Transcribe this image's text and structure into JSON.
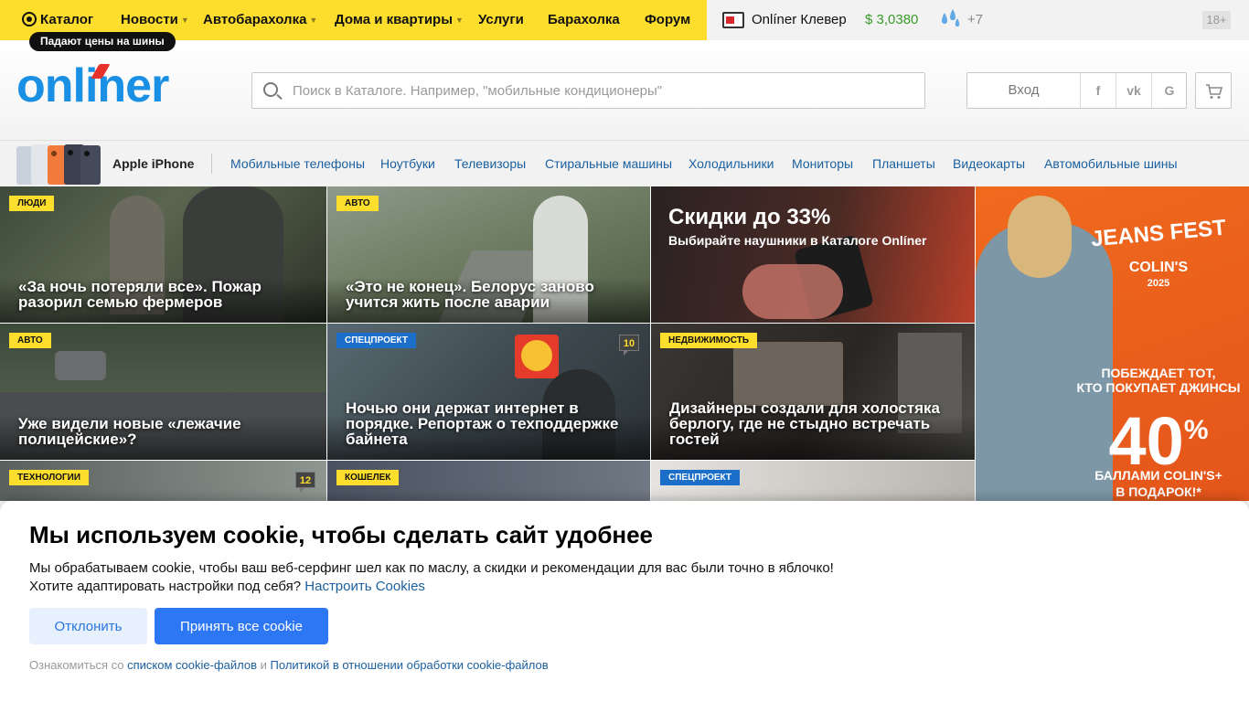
{
  "topnav": {
    "catalog": "Каталог",
    "items": [
      "Новости",
      "Автобарахолка",
      "Дома и квартиры",
      "Услуги",
      "Барахолка",
      "Форум"
    ],
    "promo": "Падают цены на шины",
    "clever": "Onlíner Клевер",
    "rate": "$ 3,0380",
    "temperature": "+7",
    "age": "18+"
  },
  "header": {
    "logo": "onliner",
    "search_placeholder": "Поиск в Каталоге. Например, \"мобильные кондиционеры\"",
    "login": "Вход",
    "social": [
      "f",
      "vk",
      "G"
    ]
  },
  "strip": {
    "featured": "Apple iPhone",
    "links": [
      "Мобильные телефоны",
      "Ноутбуки",
      "Телевизоры",
      "Стиральные машины",
      "Холодильники",
      "Мониторы",
      "Планшеты",
      "Видеокарты",
      "Автомобильные шины"
    ]
  },
  "tiles": [
    {
      "tag": "люди",
      "title": "«За ночь потеряли все». Пожар разорил семью фермеров",
      "count": ""
    },
    {
      "tag": "авто",
      "title": "«Это не конец». Белорус заново учится жить после аварии",
      "count": ""
    },
    {
      "tag": "",
      "title": "",
      "count": "",
      "promo_head": "Скидки до 33%",
      "promo_sub": "Выбирайте наушники в Каталоге Onlíner"
    },
    {
      "tag": "авто",
      "title": "Уже видели новые «лежачие полицейские»?",
      "count": ""
    },
    {
      "tag": "спецпроект",
      "title": "Ночью они держат интернет в порядке. Репортаж о техподдержке байнета",
      "count": "10"
    },
    {
      "tag": "недвижимость",
      "title": "Дизайнеры создали для холостяка берлогу, где не стыдно встречать гостей",
      "count": ""
    },
    {
      "tag": "технологии",
      "title": "",
      "count": "12"
    },
    {
      "tag": "кошелек",
      "title": "",
      "count": ""
    },
    {
      "tag": "спецпроект",
      "title": "",
      "count": ""
    }
  ],
  "ad": {
    "brand": "JEANS FEST",
    "sub": "COLIN'S",
    "year": "2025",
    "line1": "ПОБЕЖДАЕТ ТОТ,",
    "line2": "КТО ПОКУПАЕТ ДЖИНСЫ",
    "percent": "40",
    "percent_sign": "%",
    "line3": "БАЛЛАМИ COLIN'S+",
    "line4": "В ПОДАРОК!*"
  },
  "cookie": {
    "title": "Мы используем cookie, чтобы сделать сайт удобнее",
    "text": "Мы обрабатываем cookie, чтобы ваш веб-серфинг шел как по маслу, а скидки и рекомендации для вас были точно в яблочко!",
    "text2": "Хотите адаптировать настройки под себя?",
    "settings_link": "Настроить Cookies",
    "decline": "Отклонить",
    "accept": "Принять все cookie",
    "foot_prefix": "Ознакомиться со",
    "foot_link1": "списком cookie-файлов",
    "foot_and": "и",
    "foot_link2": "Политикой в отношении обработки cookie-файлов"
  },
  "colors": {
    "brand_yellow": "#fede2d",
    "brand_blue": "#1a90e5",
    "accept_blue": "#2d77f5",
    "link_blue": "#1a5f9e"
  }
}
